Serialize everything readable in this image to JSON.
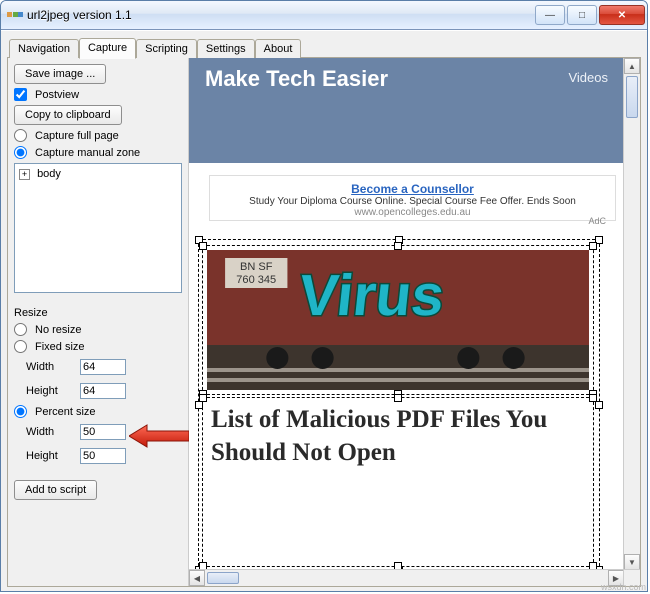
{
  "window": {
    "title": "url2jpeg version 1.1"
  },
  "tabs": {
    "items": [
      "Navigation",
      "Capture",
      "Scripting",
      "Settings",
      "About"
    ],
    "active_index": 1
  },
  "sidebar": {
    "save_image": "Save image ...",
    "postview": "Postview",
    "copy_clipboard": "Copy to clipboard",
    "capture_full": "Capture full page",
    "capture_zone": "Capture manual zone",
    "tree_root": "body",
    "resize_label": "Resize",
    "no_resize": "No resize",
    "fixed_size": "Fixed size",
    "fixed_width_label": "Width",
    "fixed_width_value": "64",
    "fixed_height_label": "Height",
    "fixed_height_value": "64",
    "percent_size": "Percent size",
    "percent_width_label": "Width",
    "percent_width_value": "50",
    "percent_height_label": "Height",
    "percent_height_value": "50",
    "add_to_script": "Add to script"
  },
  "page": {
    "banner_title": "Make Tech Easier",
    "banner_link": "Videos",
    "ad": {
      "headline": "Become a Counsellor",
      "body": "Study Your Diploma Course Online. Special Course Fee Offer. Ends Soon",
      "url": "www.opencolleges.edu.au",
      "corner": "AdC"
    },
    "article_headline": "List of Malicious PDF Files You Should Not Open",
    "train": {
      "rr": "BN SF",
      "num": "760 345",
      "graffiti": "Virus"
    }
  },
  "watermark": "wsxdn.com"
}
